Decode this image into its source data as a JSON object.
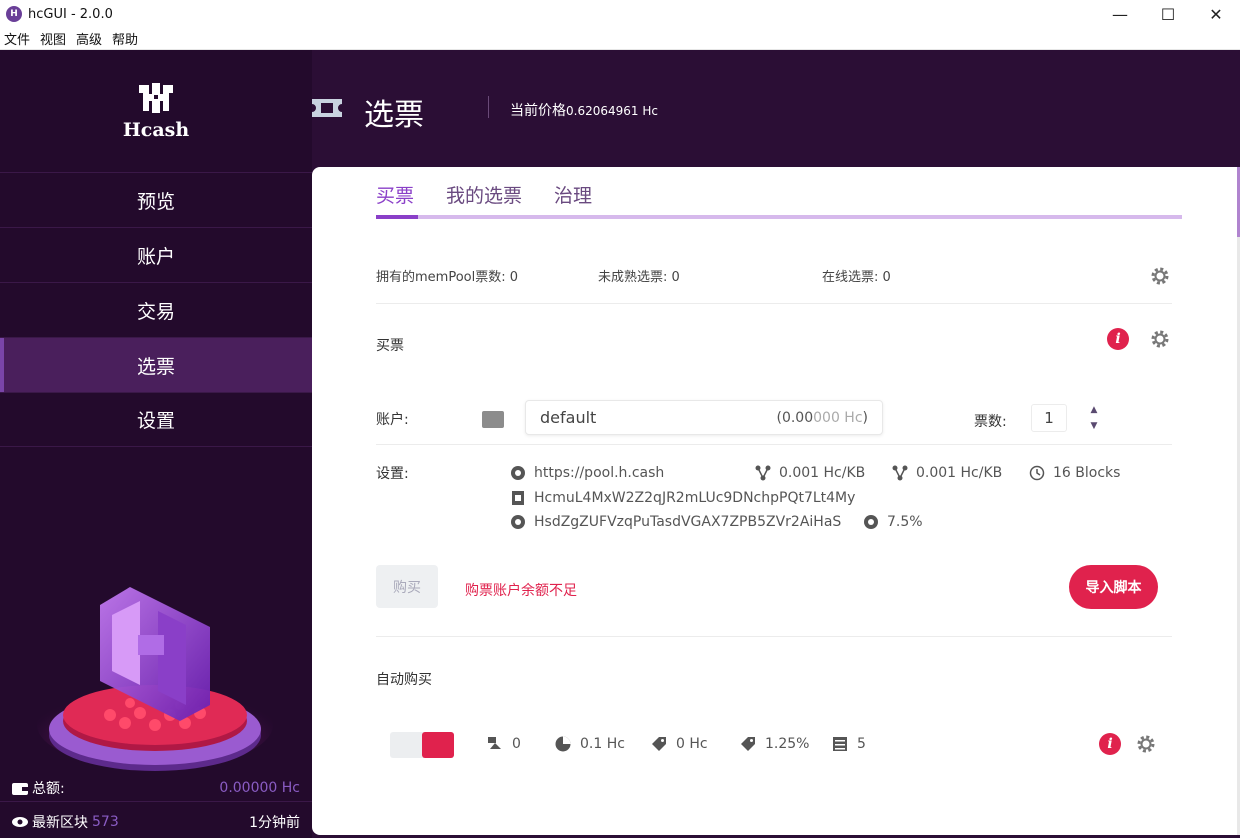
{
  "window": {
    "title": "hcGUI - 2.0.0",
    "app_icon": "hc-logo-icon",
    "controls": {
      "minimize": "—",
      "maximize": "☐",
      "close": "✕"
    }
  },
  "menu": [
    "文件",
    "视图",
    "高级",
    "帮助"
  ],
  "sidebar": {
    "logo_mark": "ℍ",
    "logo_text": "Hcash",
    "items": [
      {
        "label": "预览",
        "active": false
      },
      {
        "label": "账户",
        "active": false
      },
      {
        "label": "交易",
        "active": false
      },
      {
        "label": "选票",
        "active": true
      },
      {
        "label": "设置",
        "active": false
      }
    ],
    "total_label": "总额:",
    "total_value": "0.00000 Hc",
    "block_label": "最新区块",
    "block_value": "573",
    "block_time": "1分钟前"
  },
  "header": {
    "title": "选票",
    "price_label": "当前价格",
    "price_value": "0.62064961 Hc"
  },
  "tabs": [
    {
      "label": "买票",
      "active": true
    },
    {
      "label": "我的选票",
      "active": false
    },
    {
      "label": "治理",
      "active": false
    }
  ],
  "stats": {
    "mempool": "拥有的memPool票数: 0",
    "immature": "未成熟选票: 0",
    "live": "在线选票: 0"
  },
  "purchase": {
    "section_label": "买票",
    "account_label": "账户:",
    "account_name": "default",
    "account_balance_prefix": "(0.00",
    "account_balance_faded": "000 Hc",
    "account_balance_suffix": ")",
    "tickets_label": "票数:",
    "tickets_value": "1",
    "settings_label": "设置:",
    "pool_url": "https://pool.h.cash",
    "fee1": "0.001 Hc/KB",
    "fee2": "0.001 Hc/KB",
    "expiry": "16 Blocks",
    "ticket_address": "HcmuL4MxW2Z2qJR2mLUc9DNchpPQt7Lt4My",
    "pool_address": "HsdZgZUFVzqPuTasdVGAX7ZPB5ZVr2AiHaS",
    "pool_fee": "7.5%",
    "buy_label": "购买",
    "warning": "购票账户余额不足",
    "import_label": "导入脚本"
  },
  "auto": {
    "label": "自动购买",
    "enabled": true,
    "v1": "0",
    "v2": "0.1 Hc",
    "v3": "0 Hc",
    "v4": "1.25%",
    "v5": "5"
  },
  "colors": {
    "accent": "#8a3fc8",
    "danger": "#e0224d",
    "sidebar_bg": "#230a2c",
    "app_bg": "#2b0e35"
  }
}
